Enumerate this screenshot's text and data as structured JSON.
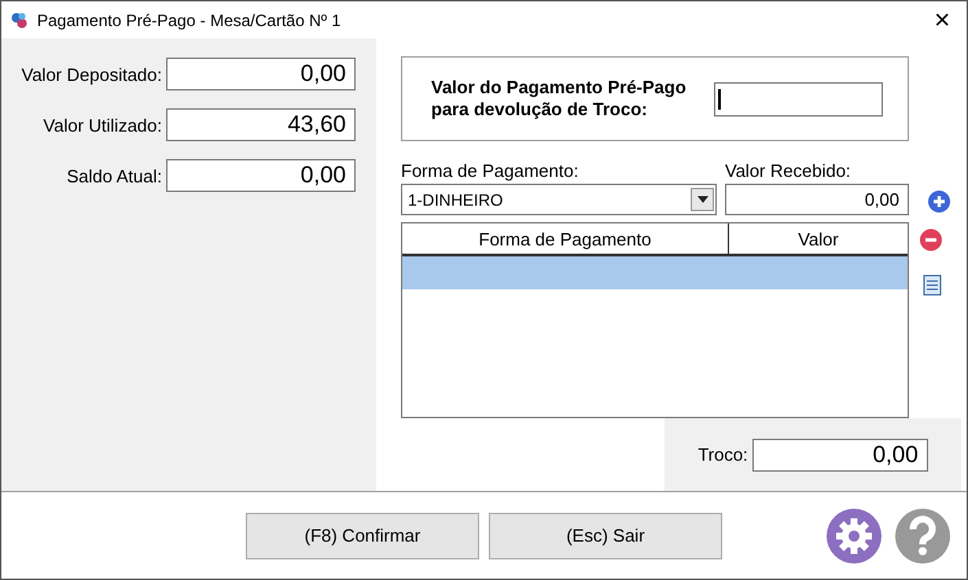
{
  "window": {
    "title": "Pagamento Pré-Pago - Mesa/Cartão Nº 1",
    "close": "×"
  },
  "summary": [
    {
      "label": "Valor Depositado:",
      "value": "0,00"
    },
    {
      "label": "Valor Utilizado:",
      "value": "43,60"
    },
    {
      "label": "Saldo Atual:",
      "value": "0,00"
    }
  ],
  "prepaid": {
    "label": "Valor do Pagamento Pré-Pago para devolução de Troco:"
  },
  "payment_method": {
    "label": "Forma de Pagamento:",
    "value": "1-DINHEIRO"
  },
  "received": {
    "label": "Valor Recebido:",
    "value": "0,00"
  },
  "table": {
    "columns": [
      "Forma de Pagamento",
      "Valor"
    ],
    "rows": [
      {
        "selected": true
      }
    ]
  },
  "change": {
    "label": "Troco:",
    "value": "0,00"
  },
  "buttons": [
    "(F8) Confirmar",
    "(Esc) Sair"
  ]
}
